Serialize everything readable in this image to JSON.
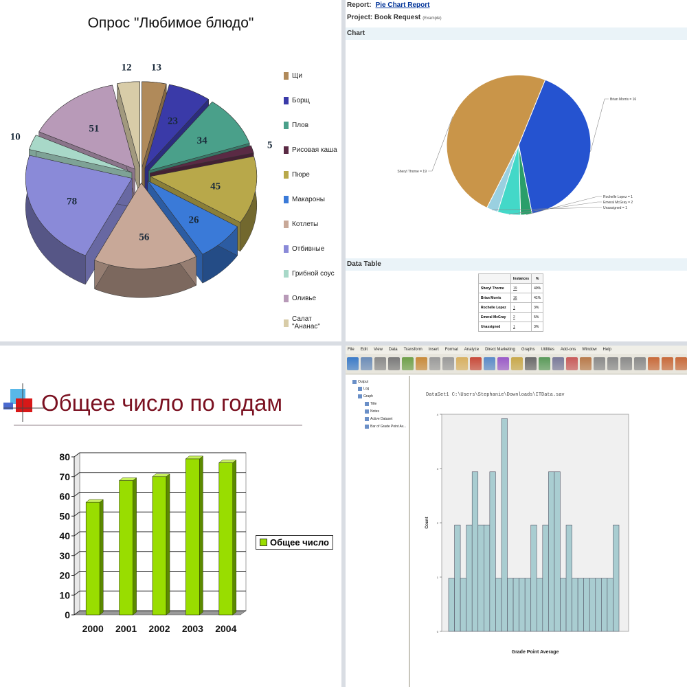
{
  "colors": {
    "green_bar": "#99dd00",
    "pie_blue": "#2553d0",
    "pie_tan": "#c99549",
    "spss_bar": "#a9cdd1"
  },
  "chart_data": [
    {
      "type": "pie",
      "title": "Опрос \"Любимое блюдо\"",
      "categories": [
        "Щи",
        "Борщ",
        "Плов",
        "Рисовая каша",
        "Пюре",
        "Макароны",
        "Котлеты",
        "Отбивные",
        "Грибной соус",
        "Оливье",
        "Салат \"Ананас\""
      ],
      "values": [
        13,
        23,
        34,
        5,
        45,
        26,
        56,
        78,
        10,
        51,
        12
      ],
      "colors": [
        "#b08a5a",
        "#3a3aa8",
        "#4aa08a",
        "#5a2a44",
        "#b8a84a",
        "#3a7ad8",
        "#c8a898",
        "#8a8ad8",
        "#a8d8c8",
        "#b89ab8",
        "#d8cca8"
      ]
    },
    {
      "type": "pie",
      "categories": [
        "Brian Morris",
        "Sheryl Thorne",
        "Rochelle Lopez",
        "Emeral McGray",
        "Unassigned"
      ],
      "labels": [
        "Brian Morris = 16",
        "Sheryl Thorne = 19",
        "Rochelle Lopez = 1",
        "Emeral McGray = 2",
        "Unassigned = 1"
      ],
      "values": [
        16,
        19,
        1,
        2,
        1
      ],
      "colors": [
        "#2553d0",
        "#c99549",
        "#2a9e6a",
        "#43d8c8",
        "#9ad0e0"
      ]
    },
    {
      "type": "bar",
      "title": "Общее число по годам",
      "categories": [
        "2000",
        "2001",
        "2002",
        "2003",
        "2004"
      ],
      "series": [
        {
          "name": "Общее число",
          "values": [
            57,
            68,
            70,
            79,
            77
          ]
        }
      ],
      "ylim": [
        0,
        80
      ],
      "yticks": [
        "0",
        "10",
        "20",
        "30",
        "40",
        "50",
        "60",
        "70",
        "80"
      ]
    },
    {
      "type": "bar",
      "xlabel": "Grade Point Average",
      "ylabel": "Count",
      "ylim": [
        0,
        4
      ],
      "yticks": [
        "0",
        "1",
        "2",
        "3",
        "4"
      ],
      "values": [
        1,
        2,
        1,
        2,
        3,
        2,
        2,
        3,
        1,
        4,
        1,
        1,
        1,
        1,
        2,
        1,
        2,
        3,
        3,
        1,
        2,
        1,
        1,
        1,
        1,
        1,
        1,
        1,
        2
      ]
    }
  ],
  "q2": {
    "report_label": "Report:",
    "report_name": "Pie Chart Report",
    "project_label": "Project: Book Request",
    "project_note": "(Example)",
    "chart_section": "Chart",
    "data_table_section": "Data Table",
    "table_headers": [
      "Instances",
      "%"
    ],
    "table_rows": [
      {
        "name": "Sheryl Thorne",
        "count": "19",
        "pct": "49%"
      },
      {
        "name": "Brian Morris",
        "count": "16",
        "pct": "41%"
      },
      {
        "name": "Rochelle Lopez",
        "count": "1",
        "pct": "3%"
      },
      {
        "name": "Emeral McGray",
        "count": "2",
        "pct": "5%"
      },
      {
        "name": "Unassigned",
        "count": "1",
        "pct": "3%"
      }
    ]
  },
  "q4": {
    "menu": [
      "File",
      "Edit",
      "View",
      "Data",
      "Transform",
      "Insert",
      "Format",
      "Analyze",
      "Direct Marketing",
      "Graphs",
      "Utilities",
      "Add-ons",
      "Window",
      "Help"
    ],
    "tree": [
      "Output",
      "Log",
      "Graph",
      "Title",
      "Notes",
      "Active Dataset",
      "Bar of Grade Point Av..."
    ],
    "path": "DataSet1 C:\\Users\\Stephanie\\Downloads\\ITData.sav"
  }
}
